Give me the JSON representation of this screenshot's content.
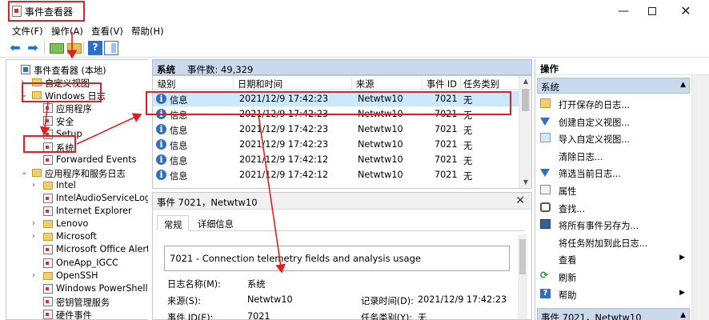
{
  "window": {
    "title": "事件查看器",
    "controls": {
      "minimize": "—",
      "close": "✕"
    }
  },
  "menu": [
    "文件(F)",
    "操作(A)",
    "查看(V)",
    "帮助(H)"
  ],
  "tree": [
    {
      "label": "事件查看器 (本地)",
      "level": 0,
      "expander": "",
      "icon": "event-viewer-icon"
    },
    {
      "label": "自定义视图",
      "level": 1,
      "expander": "›",
      "icon": "folder-icon"
    },
    {
      "label": "Windows 日志",
      "level": 1,
      "expander": "⌄",
      "icon": "folder-icon"
    },
    {
      "label": "应用程序",
      "level": 2,
      "expander": "",
      "icon": "event-log-icon"
    },
    {
      "label": "安全",
      "level": 2,
      "expander": "",
      "icon": "event-log-icon"
    },
    {
      "label": "Setup",
      "level": 2,
      "expander": "",
      "icon": "event-log-icon"
    },
    {
      "label": "系统",
      "level": 2,
      "expander": "",
      "icon": "event-log-icon"
    },
    {
      "label": "Forwarded Events",
      "level": 2,
      "expander": "",
      "icon": "event-log-icon"
    },
    {
      "label": "应用程序和服务日志",
      "level": 1,
      "expander": "⌄",
      "icon": "folder-icon"
    },
    {
      "label": "Intel",
      "level": 2,
      "expander": "›",
      "icon": "folder-icon"
    },
    {
      "label": "IntelAudioServiceLog",
      "level": 2,
      "expander": "",
      "icon": "event-log-icon"
    },
    {
      "label": "Internet Explorer",
      "level": 2,
      "expander": "",
      "icon": "event-log-icon"
    },
    {
      "label": "Lenovo",
      "level": 2,
      "expander": "›",
      "icon": "folder-icon"
    },
    {
      "label": "Microsoft",
      "level": 2,
      "expander": "›",
      "icon": "folder-icon"
    },
    {
      "label": "Microsoft Office Alerts",
      "level": 2,
      "expander": "",
      "icon": "event-log-icon"
    },
    {
      "label": "OneApp_IGCC",
      "level": 2,
      "expander": "",
      "icon": "event-log-icon"
    },
    {
      "label": "OpenSSH",
      "level": 2,
      "expander": "›",
      "icon": "folder-icon"
    },
    {
      "label": "Windows PowerShell",
      "level": 2,
      "expander": "",
      "icon": "event-log-icon"
    },
    {
      "label": "密钥管理服务",
      "level": 2,
      "expander": "",
      "icon": "event-log-icon"
    },
    {
      "label": "硬件事件",
      "level": 2,
      "expander": "",
      "icon": "event-log-icon"
    }
  ],
  "list": {
    "title": "系统",
    "count_text": "事件数: 49,329",
    "columns": [
      "级别",
      "日期和时间",
      "来源",
      "事件 ID",
      "任务类别"
    ],
    "rows": [
      {
        "level": "信息",
        "datetime": "2021/12/9 17:42:23",
        "source": "Netwtw10",
        "id": "7021",
        "category": "无"
      },
      {
        "level": "信息",
        "datetime": "2021/12/9 17:42:23",
        "source": "Netwtw10",
        "id": "7021",
        "category": "无"
      },
      {
        "level": "信息",
        "datetime": "2021/12/9 17:42:23",
        "source": "Netwtw10",
        "id": "7021",
        "category": "无"
      },
      {
        "level": "信息",
        "datetime": "2021/12/9 17:42:23",
        "source": "Netwtw10",
        "id": "7021",
        "category": "无"
      },
      {
        "level": "信息",
        "datetime": "2021/12/9 17:42:12",
        "source": "Netwtw10",
        "id": "7021",
        "category": "无"
      },
      {
        "level": "信息",
        "datetime": "2021/12/9 17:42:12",
        "source": "Netwtw10",
        "id": "7021",
        "category": "无"
      }
    ]
  },
  "detail": {
    "title": "事件 7021，Netwtw10",
    "close": "✕",
    "tabs": [
      "常规",
      "详细信息"
    ],
    "message": "7021 - Connection telemetry fields and analysis usage",
    "fields": {
      "log_name_label": "日志名称(M):",
      "log_name_value": "系统",
      "source_label": "来源(S):",
      "source_value": "Netwtw10",
      "logged_label": "记录时间(D):",
      "logged_value": "2021/12/9 17:42:23",
      "event_id_label": "事件 ID(E):",
      "event_id_value": "7021",
      "category_label": "任务类别(Y):",
      "category_value": "无"
    }
  },
  "actions": {
    "header": "操作",
    "section1": "系统",
    "items": [
      {
        "label": "打开保存的日志...",
        "icon": "open-log-icon",
        "submenu": false
      },
      {
        "label": "创建自定义视图...",
        "icon": "filter-icon",
        "submenu": false
      },
      {
        "label": "导入自定义视图...",
        "icon": "import-icon",
        "submenu": false
      },
      {
        "label": "清除日志...",
        "icon": "",
        "submenu": false
      },
      {
        "label": "筛选当前日志...",
        "icon": "filter-icon",
        "submenu": false
      },
      {
        "label": "属性",
        "icon": "properties-icon",
        "submenu": false
      },
      {
        "label": "查找...",
        "icon": "find-icon",
        "submenu": false
      },
      {
        "label": "将所有事件另存为...",
        "icon": "save-icon",
        "submenu": false
      },
      {
        "label": "将任务附加到此日志...",
        "icon": "",
        "submenu": false
      },
      {
        "label": "查看",
        "icon": "",
        "submenu": true
      },
      {
        "label": "刷新",
        "icon": "refresh-icon",
        "submenu": false
      },
      {
        "label": "帮助",
        "icon": "help-icon",
        "submenu": true
      }
    ],
    "section2": "事件 7021，Netwtw10"
  },
  "colors": {
    "annotation_red": "#e02020",
    "header_blue": "#cad9ec",
    "selection_blue": "#cce8ff"
  }
}
